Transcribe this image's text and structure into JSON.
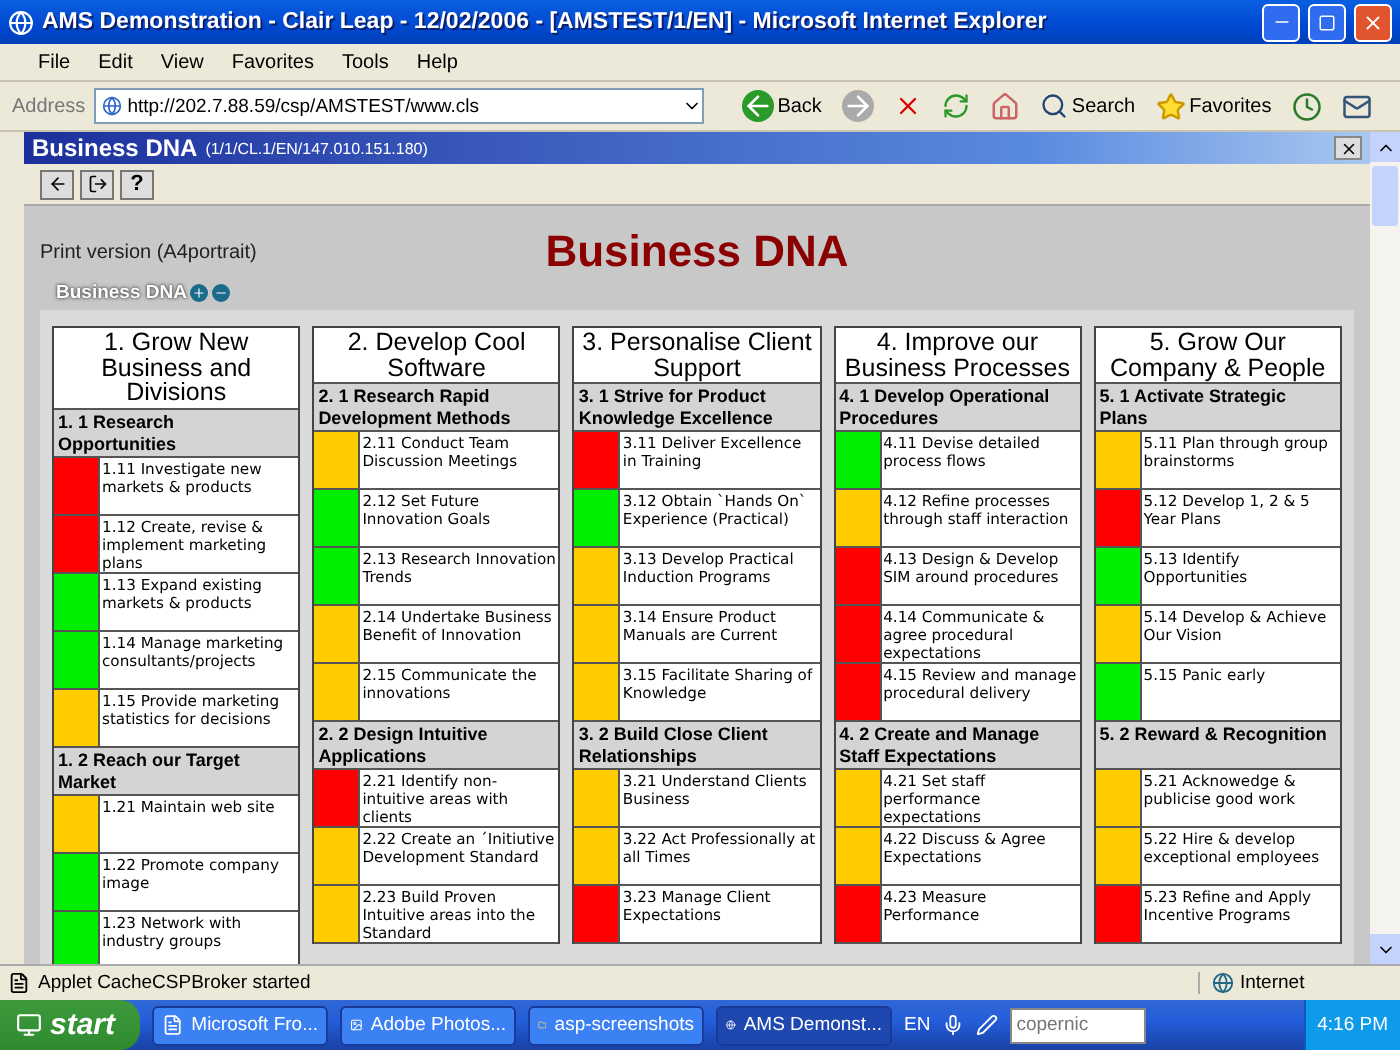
{
  "window": {
    "title": "AMS Demonstration - Clair Leap - 12/02/2006 - [AMSTEST/1/EN] - Microsoft Internet Explorer"
  },
  "menu": [
    "File",
    "Edit",
    "View",
    "Favorites",
    "Tools",
    "Help"
  ],
  "address": {
    "label": "Address",
    "value": "http://202.7.88.59/csp/AMSTEST/www.cls"
  },
  "toolbar": [
    {
      "kind": "back",
      "label": "Back"
    },
    {
      "kind": "forward"
    },
    {
      "kind": "stop"
    },
    {
      "kind": "refresh"
    },
    {
      "kind": "home"
    },
    {
      "kind": "search",
      "label": "Search"
    },
    {
      "kind": "favorites",
      "label": "Favorites"
    },
    {
      "kind": "history"
    },
    {
      "kind": "mail"
    }
  ],
  "frame": {
    "title": "Business DNA",
    "subtitle": "(1/1/CL.1/EN/147.010.151.180)"
  },
  "frame_toolbar": [
    {
      "kind": "back"
    },
    {
      "kind": "exit"
    },
    {
      "kind": "help",
      "label": "?"
    }
  ],
  "page": {
    "print_link": "Print version (A4portrait)",
    "heading": "Business DNA",
    "breadcrumb": "Business DNA"
  },
  "goals": [
    {
      "title": "1. Grow New Business and Divisions",
      "sections": [
        {
          "title": "1. 1 Research Opportunities",
          "items": [
            {
              "label": "1.11 Investigate new markets & products",
              "color": "#ff0000"
            },
            {
              "label": "1.12 Create, revise & implement marketing plans",
              "color": "#ff0000"
            },
            {
              "label": "1.13 Expand existing markets & products",
              "color": "#00ee00"
            },
            {
              "label": "1.14 Manage marketing consultants/projects",
              "color": "#00ee00"
            },
            {
              "label": "1.15 Provide marketing statistics for decisions",
              "color": "#ffcc00"
            }
          ]
        },
        {
          "title": "1. 2 Reach our Target Market",
          "items": [
            {
              "label": "1.21 Maintain web site",
              "color": "#ffcc00"
            },
            {
              "label": "1.22 Promote company image",
              "color": "#00ee00"
            },
            {
              "label": "1.23 Network with industry groups",
              "color": "#00ee00"
            }
          ]
        }
      ]
    },
    {
      "title": "2. Develop Cool Software",
      "sections": [
        {
          "title": "2. 1 Research Rapid Development Methods",
          "items": [
            {
              "label": "2.11 Conduct Team Discussion Meetings",
              "color": "#ffcc00"
            },
            {
              "label": "2.12 Set Future Innovation Goals",
              "color": "#00ee00"
            },
            {
              "label": "2.13 Research Innovation Trends",
              "color": "#00ee00"
            },
            {
              "label": "2.14 Undertake Business Benefit of Innovation",
              "color": "#ffcc00"
            },
            {
              "label": "2.15 Communicate the innovations",
              "color": "#ffcc00"
            }
          ]
        },
        {
          "title": "2. 2 Design Intuitive Applications",
          "items": [
            {
              "label": "2.21 Identify non-intuitive areas with clients",
              "color": "#ff0000"
            },
            {
              "label": "2.22 Create an ´Initiutive Development Standard",
              "color": "#ffcc00"
            },
            {
              "label": "2.23 Build Proven Intuitive areas into the Standard",
              "color": "#ffcc00"
            }
          ]
        }
      ]
    },
    {
      "title": "3. Personalise Client Support",
      "sections": [
        {
          "title": "3. 1 Strive for Product Knowledge Excellence",
          "items": [
            {
              "label": "3.11 Deliver Excellence in Training",
              "color": "#ff0000"
            },
            {
              "label": "3.12 Obtain `Hands On` Experience (Practical)",
              "color": "#00ee00"
            },
            {
              "label": "3.13 Develop Practical Induction Programs",
              "color": "#ffcc00"
            },
            {
              "label": "3.14 Ensure Product Manuals are Current",
              "color": "#ffcc00"
            },
            {
              "label": "3.15 Facilitate Sharing of Knowledge",
              "color": "#ffcc00"
            }
          ]
        },
        {
          "title": "3. 2 Build Close Client Relationships",
          "items": [
            {
              "label": "3.21 Understand Clients Business",
              "color": "#ffcc00"
            },
            {
              "label": "3.22 Act Professionally at all Times",
              "color": "#ffcc00"
            },
            {
              "label": "3.23 Manage Client Expectations",
              "color": "#ff0000"
            }
          ]
        }
      ]
    },
    {
      "title": "4. Improve our Business Processes",
      "sections": [
        {
          "title": "4. 1 Develop Operational Procedures",
          "items": [
            {
              "label": "4.11 Devise detailed process flows",
              "color": "#00ee00"
            },
            {
              "label": "4.12 Refine processes through staff interaction",
              "color": "#ffcc00"
            },
            {
              "label": "4.13 Design & Develop SIM around procedures",
              "color": "#ff0000"
            },
            {
              "label": "4.14 Communicate & agree procedural expectations",
              "color": "#ff0000"
            },
            {
              "label": "4.15 Review and manage procedural delivery",
              "color": "#ff0000"
            }
          ]
        },
        {
          "title": "4. 2 Create and Manage Staff Expectations",
          "items": [
            {
              "label": "4.21 Set staff performance expectations",
              "color": "#ffcc00"
            },
            {
              "label": "4.22 Discuss & Agree Expectations",
              "color": "#ffcc00"
            },
            {
              "label": "4.23 Measure Performance",
              "color": "#ff0000"
            }
          ]
        }
      ]
    },
    {
      "title": "5. Grow Our Company & People",
      "sections": [
        {
          "title": "5. 1 Activate Strategic Plans",
          "items": [
            {
              "label": "5.11 Plan through group brainstorms",
              "color": "#ffcc00"
            },
            {
              "label": "5.12 Develop 1, 2 & 5 Year Plans",
              "color": "#ff0000"
            },
            {
              "label": "5.13 Identify Opportunities",
              "color": "#00ee00"
            },
            {
              "label": "5.14 Develop & Achieve Our Vision",
              "color": "#ffcc00"
            },
            {
              "label": "5.15 Panic early",
              "color": "#00ee00"
            }
          ]
        },
        {
          "title": "5. 2 Reward & Recognition",
          "items": [
            {
              "label": "5.21 Acknowedge & publicise good work",
              "color": "#ffcc00"
            },
            {
              "label": "5.22 Hire & develop exceptional employees",
              "color": "#ffcc00"
            },
            {
              "label": "5.23 Refine and Apply Incentive Programs",
              "color": "#ff0000"
            }
          ]
        }
      ]
    }
  ],
  "status_bar": {
    "text": "Applet CacheCSPBroker started",
    "zone": "Internet"
  },
  "taskbar": {
    "start": "start",
    "tasks": [
      {
        "label": "Microsoft Fro...",
        "kind": "frontpage",
        "selected": false
      },
      {
        "label": "Adobe Photos...",
        "kind": "photoshop",
        "selected": false
      },
      {
        "label": "asp-screenshots",
        "kind": "folder",
        "selected": false
      },
      {
        "label": "AMS Demonst...",
        "kind": "browser",
        "selected": true
      }
    ],
    "language": "EN",
    "search_placeholder": "copernic",
    "clock": "4:16 PM"
  }
}
